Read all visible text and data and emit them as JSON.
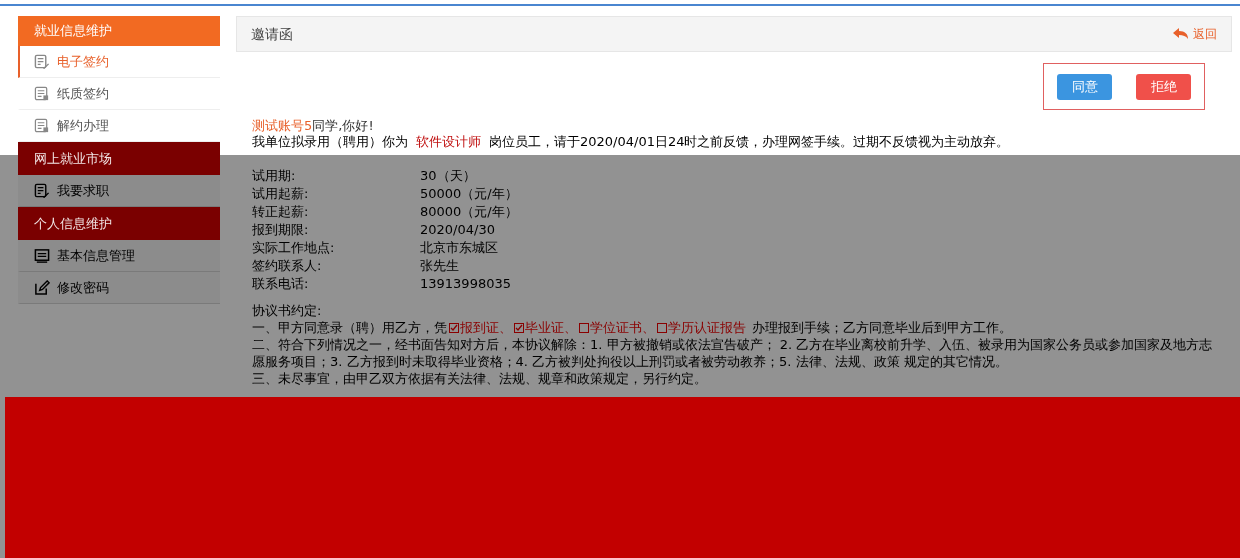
{
  "sidebar": [
    {
      "title": "就业信息维护",
      "color": "#f26a22",
      "items": [
        {
          "label": "电子签约",
          "kind": "signing",
          "selected": true
        },
        {
          "label": "纸质签约",
          "kind": "paper",
          "selected": false
        },
        {
          "label": "解约办理",
          "kind": "paper",
          "selected": false
        }
      ]
    },
    {
      "title": "网上就业市场",
      "color": "#7a0000",
      "items": [
        {
          "label": "我要求职",
          "kind": "signing",
          "selected": false
        }
      ]
    },
    {
      "title": "个人信息维护",
      "color": "#7a0000",
      "items": [
        {
          "label": "基本信息管理",
          "kind": "info",
          "selected": false
        },
        {
          "label": "修改密码",
          "kind": "password",
          "selected": false
        }
      ]
    }
  ],
  "panel": {
    "title": "邀请函",
    "back": "返回",
    "buttons": [
      {
        "label": "同意",
        "kind": "agree"
      },
      {
        "label": "拒绝",
        "kind": "reject"
      }
    ],
    "greeting_name": "测试账号5",
    "greeting_rest": "同学,你好!",
    "offer": {
      "before": "我单位拟录用（聘用）你为",
      "position": "软件设计师",
      "after": "岗位员工，请于2020/04/01日24时之前反馈，办理网签手续。过期不反馈视为主动放弃。"
    },
    "fields": [
      {
        "label": "试用期:",
        "value": "30（天）"
      },
      {
        "label": "试用起薪:",
        "value": "50000（元/年）"
      },
      {
        "label": "转正起薪:",
        "value": "80000（元/年）"
      },
      {
        "label": "报到期限:",
        "value": "2020/04/30"
      },
      {
        "label": "实际工作地点:",
        "value": "北京市东城区"
      },
      {
        "label": "签约联系人:",
        "value": "张先生"
      },
      {
        "label": "联系电话:",
        "value": "13913998035"
      }
    ],
    "agreement_title": "协议书约定:",
    "clause_1": {
      "before": "一、甲方同意录（聘）用乙方，凭",
      "documents": [
        {
          "label": "报到证、",
          "checked": true
        },
        {
          "label": "毕业证、",
          "checked": true
        },
        {
          "label": "学位证书、",
          "checked": false
        },
        {
          "label": "学历认证报告",
          "checked": false
        }
      ],
      "after": "办理报到手续；乙方同意毕业后到甲方工作。"
    },
    "clauses": [
      "二、符合下列情况之一，经书面告知对方后，本协议解除：1. 甲方被撤销或依法宣告破产； 2. 乙方在毕业离校前升学、入伍、被录用为国家公务员或参加国家及地方志愿服务项目；3. 乙方报到时未取得毕业资格；4. 乙方被判处拘役以上刑罚或者被劳动教养；5. 法律、法规、政策 规定的其它情况。",
      "三、未尽事宜，由甲乙双方依据有关法律、法规、规章和政策规定，另行约定。"
    ]
  }
}
